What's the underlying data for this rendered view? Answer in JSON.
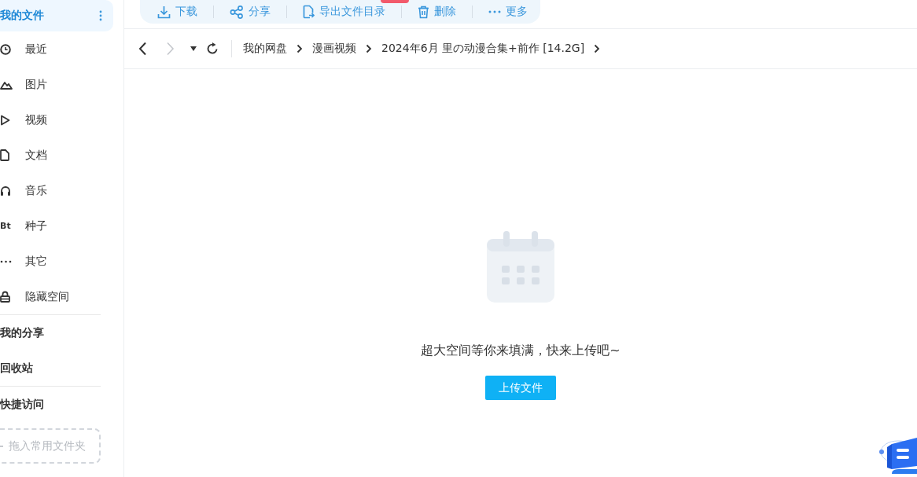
{
  "sidebar": {
    "header": {
      "label": "我的文件",
      "selected": true
    },
    "items": [
      {
        "kind": "recent",
        "label": "最近",
        "selected": false
      },
      {
        "kind": "image",
        "label": "图片",
        "selected": false
      },
      {
        "kind": "video",
        "label": "视频",
        "selected": false
      },
      {
        "kind": "doc",
        "label": "文档",
        "selected": false
      },
      {
        "kind": "music",
        "label": "音乐",
        "selected": false
      },
      {
        "kind": "text",
        "icon_text": "Bt",
        "label": "种子",
        "selected": false
      },
      {
        "kind": "other",
        "label": "其它",
        "selected": false
      },
      {
        "kind": "lock",
        "label": "隐藏空间",
        "selected": false
      }
    ],
    "sections": [
      {
        "label": "我的分享"
      },
      {
        "label": "回收站"
      }
    ],
    "quick_access": {
      "title": "快捷访问",
      "drop_zone": "拖入常用文件夹"
    }
  },
  "toolbar": [
    {
      "kind": "download",
      "label": "下载"
    },
    {
      "kind": "share",
      "label": "分享"
    },
    {
      "kind": "export",
      "label": "导出文件目录"
    },
    {
      "kind": "delete",
      "label": "删除"
    },
    {
      "kind": "more",
      "label": "更多"
    }
  ],
  "navigation": {
    "back": {
      "disabled": false
    },
    "forward": {
      "disabled": true
    }
  },
  "breadcrumb": [
    "我的网盘",
    "漫画视频",
    "2024年6月 里の动漫合集+前作 [14.2G]"
  ],
  "empty_state": {
    "message": "超大空间等你来填满，快来上传吧~",
    "button": "上传文件"
  }
}
